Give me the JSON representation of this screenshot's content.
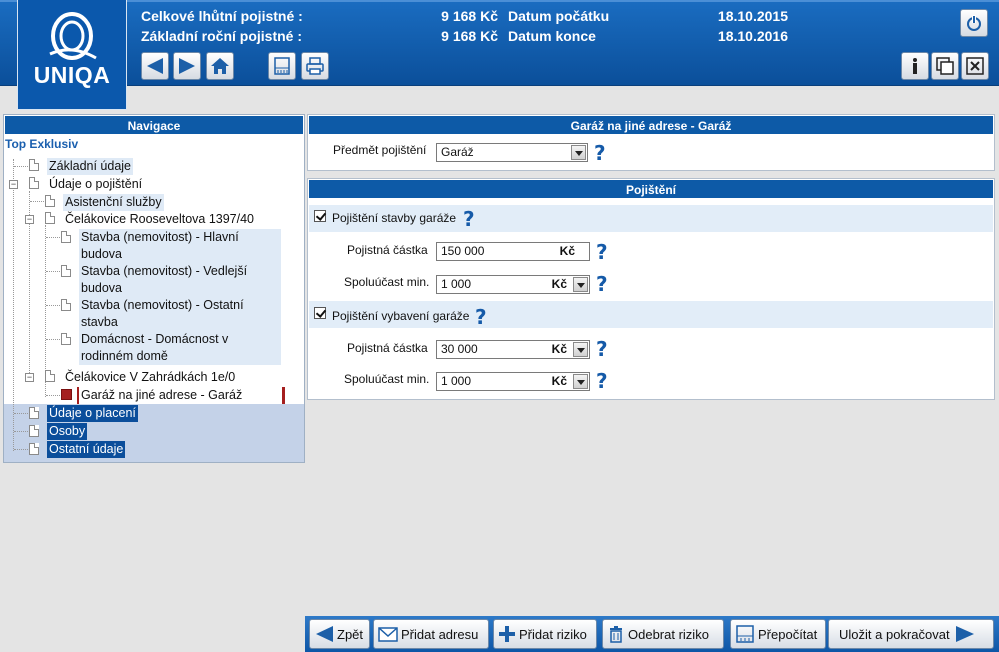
{
  "brand": {
    "logo_text": "UNIQA"
  },
  "header": {
    "total_premium_label": "Celkové lhůtní pojistné :",
    "total_premium_value": "9 168 Kč",
    "annual_premium_label": "Základní roční pojistné :",
    "annual_premium_value": "9 168 Kč",
    "start_date_label": "Datum počátku",
    "start_date_value": "18.10.2015",
    "end_date_label": "Datum konce",
    "end_date_value": "18.10.2016"
  },
  "toolbar_icons": {
    "back": "arrow-left-icon",
    "forward": "arrow-right-icon",
    "home": "home-icon",
    "calculator": "calculator-icon",
    "print": "printer-icon",
    "power": "power-icon",
    "info": "info-icon",
    "windows": "windows-icon",
    "close": "close-icon"
  },
  "nav": {
    "title": "Navigace",
    "product": "Top Exklusiv",
    "items": [
      {
        "label": "Základní údaje"
      },
      {
        "label": "Údaje o pojištění"
      },
      {
        "label": "Asistenční služby"
      },
      {
        "label": "Čelákovice Rooseveltova 1397/40"
      },
      {
        "label_1": "Stavba (nemovitost) - Hlavní",
        "label_2": "budova"
      },
      {
        "label_1": "Stavba (nemovitost) - Vedlejší",
        "label_2": "budova"
      },
      {
        "label_1": "Stavba (nemovitost) - Ostatní",
        "label_2": "stavba"
      },
      {
        "label_1": "Domácnost - Domácnost v",
        "label_2": "rodinném domě"
      },
      {
        "label": "Čelákovice V Zahrádkách 1e/0"
      },
      {
        "label": "Garáž na jiné adrese - Garáž"
      },
      {
        "label": "Údaje o placení"
      },
      {
        "label": "Osoby"
      },
      {
        "label": "Ostatní údaje"
      }
    ]
  },
  "garage_panel": {
    "title": "Garáž na jiné adrese - Garáž",
    "subject_label": "Předmět pojištění",
    "subject_value": "Garáž"
  },
  "insurance_panel": {
    "title": "Pojištění",
    "building": {
      "checkbox_label": "Pojištění stavby garáže",
      "checked": true,
      "sum_label": "Pojistná částka",
      "sum_value": "150 000",
      "sum_unit": "Kč",
      "deductible_label": "Spoluúčast min.",
      "deductible_value": "1 000",
      "deductible_unit": "Kč"
    },
    "contents": {
      "checkbox_label": "Pojištění vybavení garáže",
      "checked": true,
      "sum_label": "Pojistná částka",
      "sum_value": "30 000",
      "sum_unit": "Kč",
      "deductible_label": "Spoluúčast min.",
      "deductible_value": "1 000",
      "deductible_unit": "Kč"
    }
  },
  "help_symbol": "?",
  "bottom_bar": {
    "back": "Zpět",
    "add_address": "Přidat adresu",
    "add_risk": "Přidat riziko",
    "remove_risk": "Odebrat riziko",
    "recalculate": "Přepočítat",
    "save_continue": "Uložit a pokračovat"
  },
  "colors": {
    "header_blue": "#0b58ac",
    "panel_title_blue": "#0d5aa7",
    "selected_nav": "#0b4e9b",
    "help_blue": "#155aa8",
    "section_band": "#e2edf8"
  }
}
